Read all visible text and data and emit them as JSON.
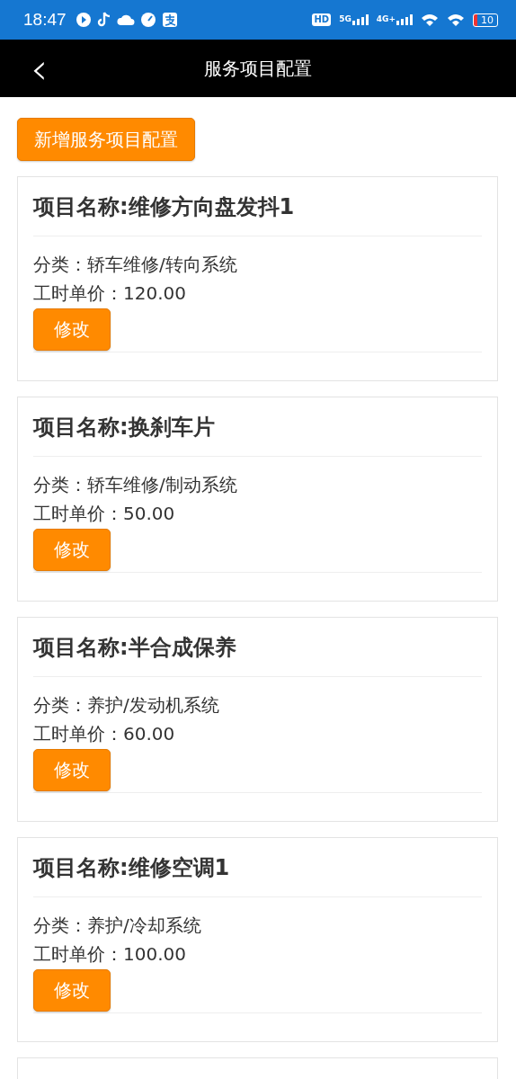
{
  "status_bar": {
    "time": "18:47",
    "network_labels": [
      {
        "text": "HD"
      },
      {
        "text": "5G"
      },
      {
        "text": "4G+"
      }
    ],
    "battery": "10"
  },
  "header": {
    "back_icon": "‹",
    "title": "服务项目配置"
  },
  "add_button": "新增服务项目配置",
  "items": [
    {
      "name": "项目名称:维修方向盘发抖1",
      "category": "分类：轿车维修/转向系统",
      "price": "工时单价：120.00",
      "edit_button": "修改"
    },
    {
      "name": "项目名称:换刹车片",
      "category": "分类：轿车维修/制动系统",
      "price": "工时单价：50.00",
      "edit_button": "修改"
    },
    {
      "name": "项目名称:半合成保养",
      "category": "分类：养护/发动机系统",
      "price": "工时单价：60.00",
      "edit_button": "修改"
    },
    {
      "name": "项目名称:维修空调1",
      "category": "分类：养护/冷却系统",
      "price": "工时单价：100.00",
      "edit_button": "修改"
    }
  ]
}
